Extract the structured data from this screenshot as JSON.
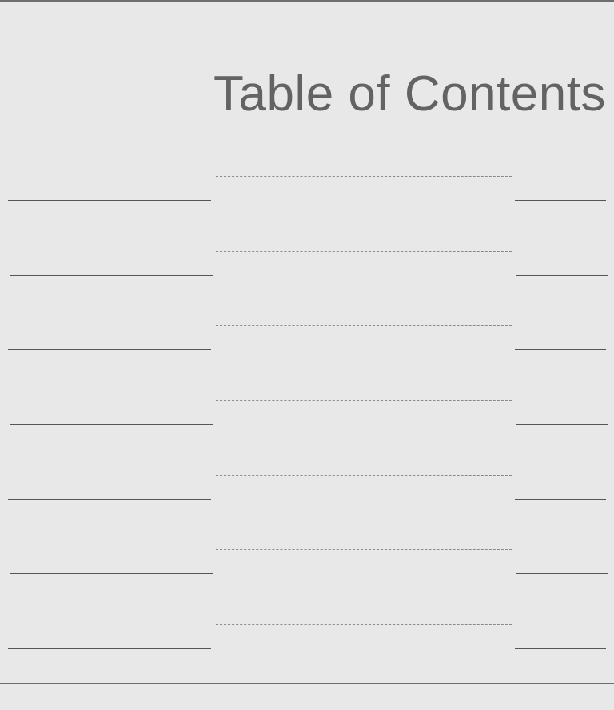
{
  "document": {
    "title": "Table of Contents"
  },
  "toc": {
    "entries": [
      {
        "title": "",
        "page": ""
      },
      {
        "title": "",
        "page": ""
      },
      {
        "title": "",
        "page": ""
      },
      {
        "title": "",
        "page": ""
      },
      {
        "title": "",
        "page": ""
      },
      {
        "title": "",
        "page": ""
      },
      {
        "title": "",
        "page": ""
      }
    ]
  }
}
